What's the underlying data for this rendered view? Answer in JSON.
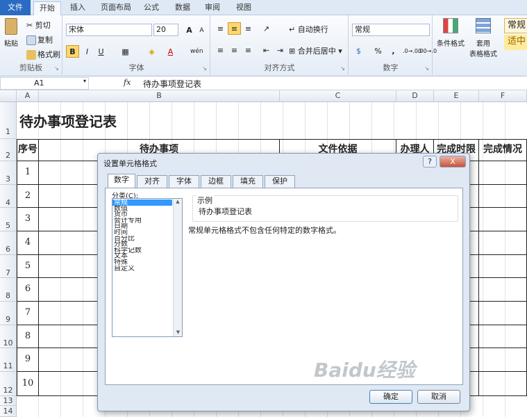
{
  "tabs": [
    "文件",
    "开始",
    "插入",
    "页面布局",
    "公式",
    "数据",
    "审阅",
    "视图"
  ],
  "clipboard": {
    "paste": "粘贴",
    "cut": "剪切",
    "copy": "复制",
    "painter": "格式刷",
    "label": "剪贴板"
  },
  "font": {
    "name": "宋体",
    "size": "20",
    "label": "字体",
    "bold": "B",
    "italic": "I",
    "underline": "U",
    "grow": "A",
    "shrink": "A",
    "color_a": "A",
    "phonetic": "wén"
  },
  "alignment": {
    "wrap": "自动换行",
    "merge": "合并后居中",
    "label": "对齐方式"
  },
  "number": {
    "format": "常规",
    "percent": "%",
    "comma": ",",
    "inc": ".0→.00",
    "dec": ".00→.0",
    "label": "数字"
  },
  "styles": {
    "cond": "条件格式",
    "table": "套用",
    "table2": "表格格式",
    "normal": "常规",
    "medium": "适中"
  },
  "formula_bar": {
    "cell": "A1",
    "fx": "fx",
    "content": "待办事项登记表"
  },
  "columns": [
    "A",
    "B",
    "C",
    "D",
    "E",
    "F"
  ],
  "rows": [
    "1",
    "2",
    "3",
    "4",
    "5",
    "6",
    "7",
    "8",
    "9",
    "10",
    "11",
    "12",
    "13",
    "14"
  ],
  "sheet": {
    "title": "待办事项登记表",
    "headers": [
      "序号",
      "待办事项",
      "文件依据",
      "办理人",
      "完成时限",
      "完成情况"
    ],
    "numbers": [
      "1",
      "2",
      "3",
      "4",
      "5",
      "6",
      "7",
      "8",
      "9",
      "10"
    ]
  },
  "dialog": {
    "title": "设置单元格格式",
    "help": "?",
    "close": "X",
    "tabs": [
      "数字",
      "对齐",
      "字体",
      "边框",
      "填充",
      "保护"
    ],
    "category_label": "分类(C):",
    "categories": [
      "常规",
      "数值",
      "货币",
      "会计专用",
      "日期",
      "时间",
      "百分比",
      "分数",
      "科学记数",
      "文本",
      "特殊",
      "自定义"
    ],
    "sample_label": "示例",
    "sample_value": "待办事项登记表",
    "description": "常规单元格格式不包含任何特定的数字格式。",
    "ok": "确定",
    "cancel": "取消"
  },
  "watermark": "Baidu经验"
}
